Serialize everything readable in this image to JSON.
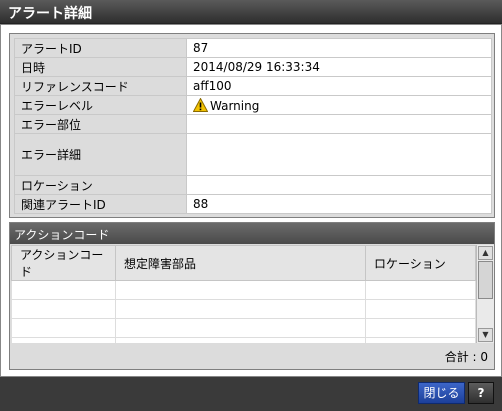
{
  "window": {
    "title": "アラート詳細"
  },
  "details": [
    {
      "label": "アラートID",
      "value": "87"
    },
    {
      "label": "日時",
      "value": "2014/08/29 16:33:34"
    },
    {
      "label": "リファレンスコード",
      "value": "aff100"
    },
    {
      "label": "エラーレベル",
      "value": "Warning",
      "icon": "warning-icon"
    },
    {
      "label": "エラー部位",
      "value": ""
    },
    {
      "label": "エラー詳細",
      "value": ""
    },
    {
      "label": "ロケーション",
      "value": ""
    },
    {
      "label": "関連アラートID",
      "value": "88"
    }
  ],
  "actions": {
    "section_title": "アクションコード",
    "columns": [
      "アクションコード",
      "想定障害部品",
      "ロケーション"
    ],
    "total": "合計 : 0"
  },
  "footer": {
    "close_label": "閉じる",
    "help_label": "?"
  },
  "colors": {
    "warning": "#f2c200",
    "close_button": "#2a52b8",
    "title_bar": "#3a3a3a"
  }
}
